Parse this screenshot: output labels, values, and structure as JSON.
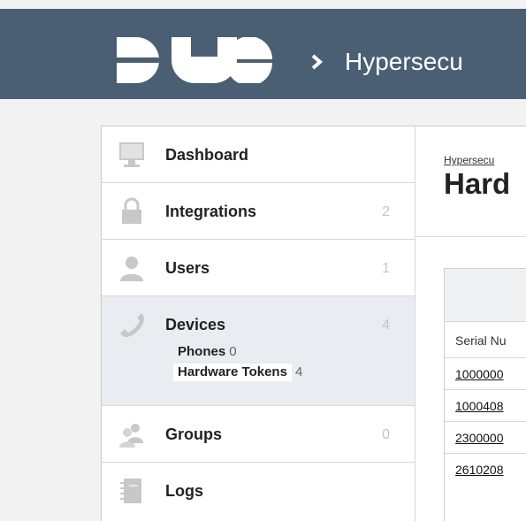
{
  "header": {
    "org_name": "Hypersecu",
    "logo": "duo-logo"
  },
  "sidebar": {
    "items": [
      {
        "label": "Dashboard",
        "count": "",
        "icon": "monitor-icon"
      },
      {
        "label": "Integrations",
        "count": "2",
        "icon": "lock-icon"
      },
      {
        "label": "Users",
        "count": "1",
        "icon": "user-icon"
      },
      {
        "label": "Devices",
        "count": "4",
        "icon": "phone-handset-icon",
        "subitems": [
          {
            "label": "Phones",
            "count": "0"
          },
          {
            "label": "Hardware Tokens",
            "count": "4"
          }
        ]
      },
      {
        "label": "Groups",
        "count": "0",
        "icon": "group-icon"
      },
      {
        "label": "Logs",
        "count": "",
        "icon": "notebook-icon"
      }
    ]
  },
  "main": {
    "breadcrumb": "Hypersecu",
    "title": "Hard",
    "table": {
      "column_header": "Serial Nu",
      "rows": [
        "1000000",
        "1000408",
        "2300000",
        "2610208"
      ]
    }
  },
  "colors": {
    "header_bg": "#4a5f74",
    "page_bg": "#f2f2f2",
    "active_bg": "#e9edf1",
    "icon_gray": "#c2c2c2"
  }
}
